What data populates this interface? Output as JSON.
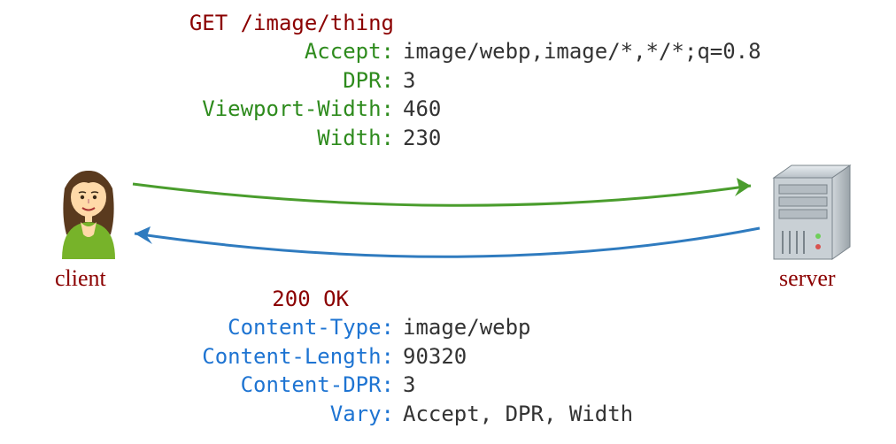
{
  "request": {
    "line": "GET /image/thing",
    "headers": [
      {
        "key": "Accept:",
        "value": "image/webp,image/*,*/*;q=0.8"
      },
      {
        "key": "DPR:",
        "value": "3"
      },
      {
        "key": "Viewport-Width:",
        "value": "460"
      },
      {
        "key": "Width:",
        "value": "230"
      }
    ]
  },
  "response": {
    "status": "200 OK",
    "headers": [
      {
        "key": "Content-Type:",
        "value": "image/webp"
      },
      {
        "key": "Content-Length:",
        "value": "90320"
      },
      {
        "key": "Content-DPR:",
        "value": "3"
      },
      {
        "key": "Vary:",
        "value": "Accept, DPR, Width"
      }
    ]
  },
  "labels": {
    "client": "client",
    "server": "server"
  },
  "colors": {
    "request_color": "#4a9d2d",
    "response_color": "#2f7bbf",
    "emphasis_color": "#8b0000"
  }
}
